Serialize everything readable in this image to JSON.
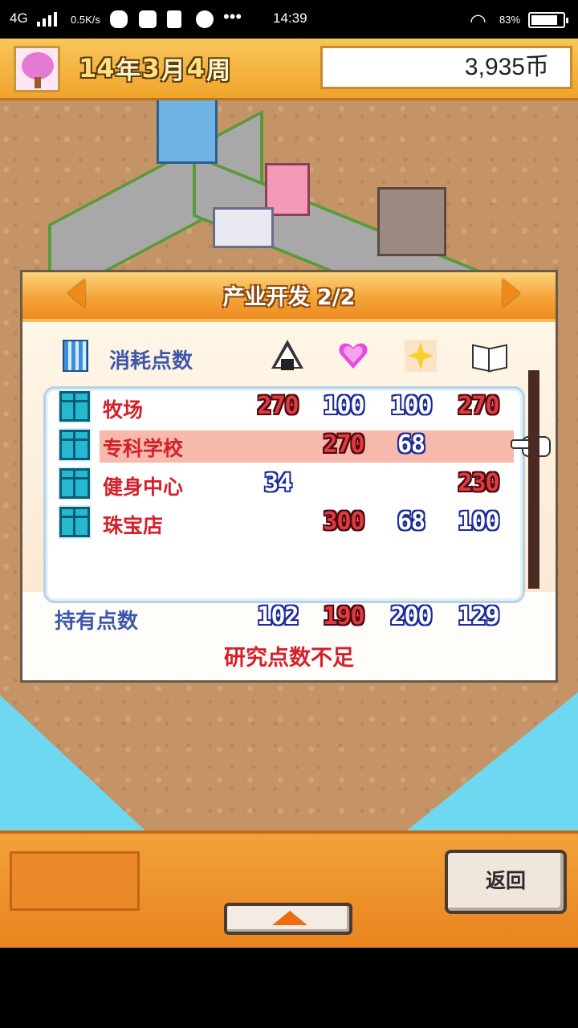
{
  "status_bar": {
    "network": "4G",
    "speed": "0.5K/s",
    "time": "14:39",
    "battery": "83%",
    "battery_level": 0.83,
    "icons": [
      "signal-icon",
      "wechat-icon",
      "notification-icon",
      "volume-icon",
      "check-icon",
      "more-icon",
      "wifi-icon",
      "battery-icon"
    ]
  },
  "top_bar": {
    "year_num": "14",
    "year_unit": "年",
    "month_num": "3",
    "month_unit": "月",
    "week_num": "4",
    "week_unit": "周",
    "coins": "3,935币"
  },
  "dialog": {
    "title": "产业开发 2/2",
    "cost_label": "消耗点数",
    "resource_icons": [
      "onigiri-icon",
      "heart-icon",
      "sparkle-icon",
      "book-icon"
    ],
    "rows": [
      {
        "label": "牧场",
        "values": [
          "270",
          "100",
          "100",
          "270"
        ],
        "colors": [
          "r",
          "b",
          "b",
          "r"
        ],
        "selected": false
      },
      {
        "label": "专科学校",
        "values": [
          "",
          "270",
          "68",
          ""
        ],
        "colors": [
          "",
          "r",
          "b",
          ""
        ],
        "selected": true
      },
      {
        "label": "健身中心",
        "values": [
          "34",
          "",
          "",
          "230"
        ],
        "colors": [
          "b",
          "",
          "",
          "r"
        ],
        "selected": false
      },
      {
        "label": "珠宝店",
        "values": [
          "",
          "300",
          "68",
          "100"
        ],
        "colors": [
          "",
          "r",
          "b",
          "b"
        ],
        "selected": false
      }
    ],
    "held_label": "持有点数",
    "held_values": [
      "102",
      "190",
      "200",
      "129"
    ],
    "held_colors": [
      "b",
      "r",
      "b",
      "b"
    ],
    "warning": "研究点数不足"
  },
  "bottom": {
    "back_label": "返回"
  },
  "colors": {
    "accent_orange": "#f1a42b",
    "cost_red": "#e03a42",
    "ok_blue": "#1c2a9a",
    "warning_red": "#d4202a"
  }
}
